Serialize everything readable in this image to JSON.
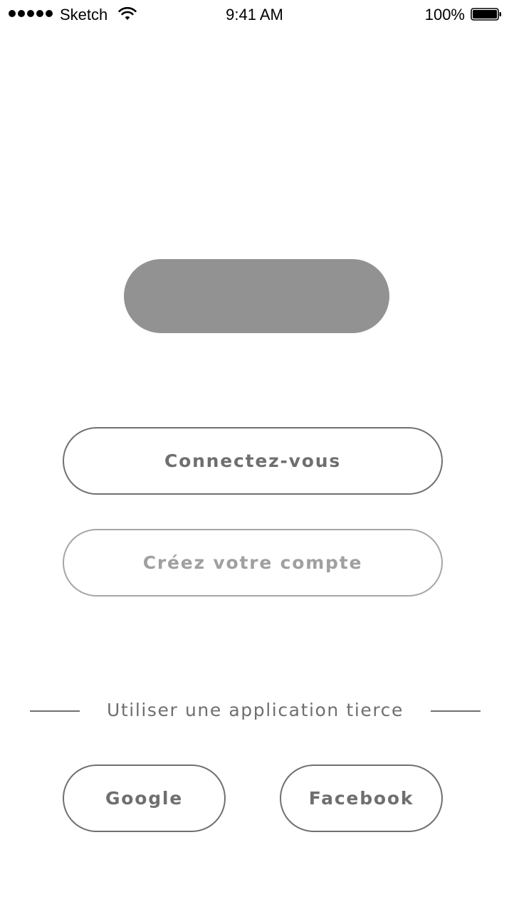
{
  "status_bar": {
    "carrier": "Sketch",
    "time": "9:41 AM",
    "battery_percent": "100%",
    "battery_level": 1.0,
    "signal_bars": 5,
    "icons": [
      "signal-dots-icon",
      "wifi-icon",
      "battery-icon"
    ]
  },
  "logo": {
    "color": "#929292"
  },
  "buttons": {
    "login_label": "Connectez-vous",
    "signup_label": "Créez votre compte",
    "google_label": "Google",
    "facebook_label": "Facebook"
  },
  "third_party": {
    "divider_label": "Utiliser une application tierce"
  },
  "colors": {
    "outline": "#707070",
    "outline_muted": "#a6a6a6",
    "text": "#6f6f6f",
    "text_muted": "#a0a0a0",
    "placeholder": "#929292"
  }
}
